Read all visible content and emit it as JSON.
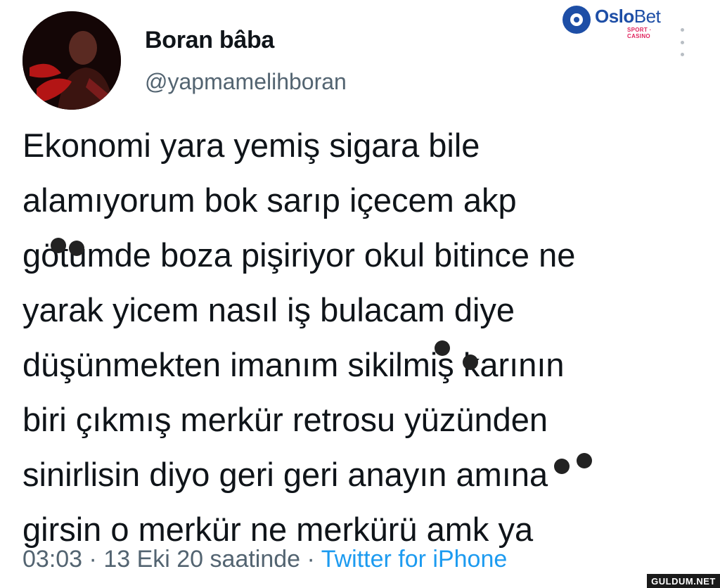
{
  "user": {
    "display_name": "Boran bâba",
    "handle": "@yapmamelihboran"
  },
  "tweet": {
    "lines": [
      "Ekonomi yara yemiş sigara bile",
      "alamıyorum bok sarıp içecem akp",
      "götümde boza pişiriyor okul bitince ne",
      "yarak yicem nasıl iş bulacam diye",
      "düşünmekten imanım sikilmiş karının",
      "biri çıkmış merkür retrosu yüzünden",
      "sinirlisin diyo geri geri anayın amına",
      "girsin o merkür ne merkürü amk ya"
    ],
    "time": "03:03",
    "separator": "·",
    "date": "13 Eki 20 saatinde",
    "source": "Twitter for iPhone"
  },
  "overlay": {
    "brand_name_bold": "Oslo",
    "brand_name_rest": "Bet",
    "brand_tagline": "SPORT · CASINO",
    "watermark": "GULDUM.NET"
  },
  "colors": {
    "text": "#0f1419",
    "secondary": "#536471",
    "link": "#1d9bf0",
    "brand": "#1d4ea6"
  },
  "icons": {
    "more": "more-vertical-icon",
    "brand_logo": "oslobet-logo-icon"
  }
}
